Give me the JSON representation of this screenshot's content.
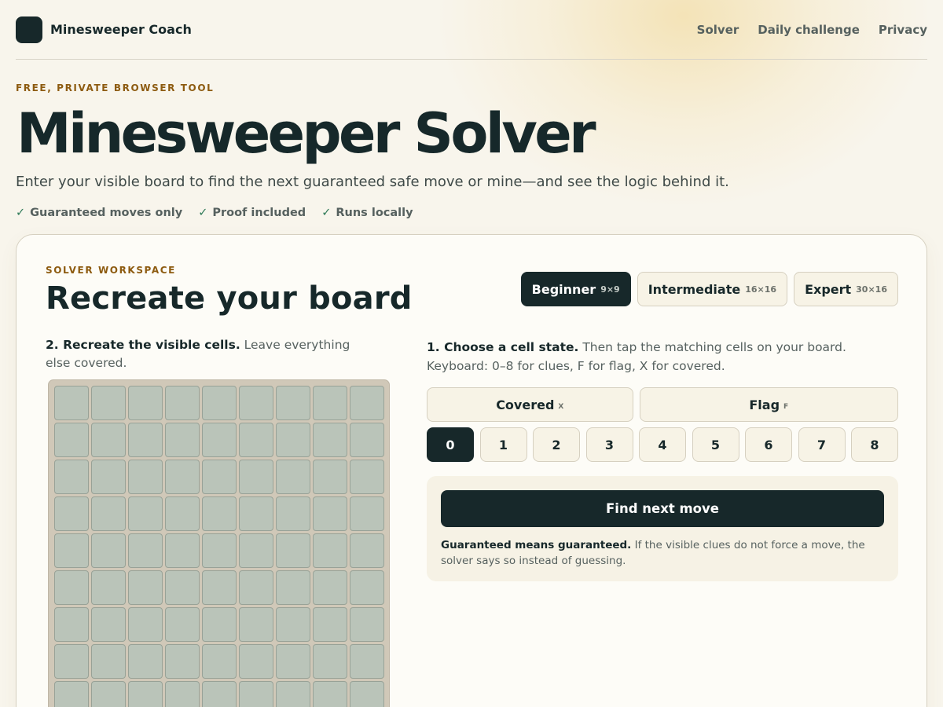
{
  "header": {
    "brand": "Minesweeper Coach",
    "nav": [
      "Solver",
      "Daily challenge",
      "Privacy"
    ]
  },
  "hero": {
    "eyebrow": "FREE, PRIVATE BROWSER TOOL",
    "title": "Minesweeper Solver",
    "subtitle": "Enter your visible board to find the next guaranteed safe move or mine—and see the logic behind it.",
    "checks": [
      "Guaranteed moves only",
      "Proof included",
      "Runs locally"
    ],
    "check_glyph": "✓"
  },
  "workspace": {
    "eyebrow": "SOLVER WORKSPACE",
    "title": "Recreate your board",
    "levels": [
      {
        "name": "Beginner",
        "size": "9×9",
        "active": true
      },
      {
        "name": "Intermediate",
        "size": "16×16",
        "active": false
      },
      {
        "name": "Expert",
        "size": "30×16",
        "active": false
      }
    ],
    "board_caption_bold": "2. Recreate the visible cells.",
    "board_caption_rest": "Leave everything else covered.",
    "board": {
      "columns": 9,
      "rows": 9,
      "cell_state": "covered"
    },
    "state_caption_bold": "1. Choose a cell state.",
    "state_caption_rest": "Then tap the matching cells on your board. Keyboard: 0–8 for clues, F for flag, X for covered.",
    "states": {
      "covered": {
        "label": "Covered",
        "key": "X"
      },
      "flag": {
        "label": "Flag",
        "key": "F"
      }
    },
    "numbers": [
      "0",
      "1",
      "2",
      "3",
      "4",
      "5",
      "6",
      "7",
      "8"
    ],
    "selected_number": "0",
    "find_button": "Find next move",
    "note_bold": "Guaranteed means guaranteed.",
    "note_rest": "If the visible clues do not force a move, the solver says so instead of guessing."
  },
  "colors": {
    "ink": "#17282a",
    "accent_eyebrow": "#8d5b10",
    "cell": "#bac4b9",
    "board": "#d0c8b8",
    "check": "#2f7a58"
  }
}
